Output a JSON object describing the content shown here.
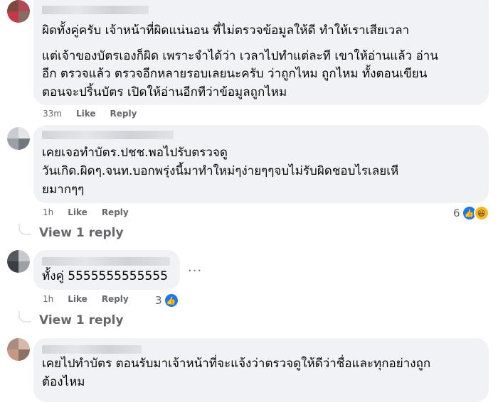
{
  "comments": [
    {
      "lines": [
        "ผิดทั้งคู่ครับ เจ้าหน้าที่ผิดแน่นอน ที่ไม่ตรวจข้อมูลให้ดี ทำให้เราเสียเวลา",
        "",
        "แต่เจ้าของบัตรเองก็ผิด เพราะจำได้ว่า เวลาไปทำแต่ละที เขาให้อ่านแล้ว อ่าน",
        "อีก ตรวจแล้ว ตรวจอีกหลายรอบเลยนะครับ ว่าถูกไหม ถูกไหม ทั้งตอนเขียน",
        "ตอนจะปริ้นบัตร เปิดให้อ่านอีกทีว่าข้อมูลถูกไหม"
      ],
      "time": "33m",
      "like": "Like",
      "reply": "Reply"
    },
    {
      "lines": [
        "เคยเจอทำบัตร.ปชช.พอไปรับตรวจดู",
        "วันเกิด.ผิดๆ.จนท.บอกพรุ่งนี้มาทำใหม่ๆง่ายๆๆจบไม่รับผิดชอบไรเลยเหี",
        "ยมากๆๆ"
      ],
      "time": "1h",
      "like": "Like",
      "reply": "Reply",
      "reaction_count": "6",
      "reaction_icons": [
        "like-icon",
        "haha-icon"
      ]
    },
    {
      "lines": [
        "ทั้งคู่ 5555555555555"
      ],
      "time": "1h",
      "like": "Like",
      "reply": "Reply",
      "reaction_count": "3",
      "reaction_icons": [
        "like-icon"
      ],
      "more": "..."
    },
    {
      "lines": [
        "เคยไปทำบัตร ตอนรับมาเจ้าหน้าที่จะแจ้งว่าตรวจดูให้ดีว่าชื่อและทุกอย่างถูก",
        "ต้องไหม"
      ]
    }
  ],
  "view_replies": [
    "View 1 reply",
    "View 1 reply"
  ],
  "colors": {
    "bubble": "#f0f2f5",
    "meta": "#65676b",
    "like_blue": "#1877f2"
  }
}
